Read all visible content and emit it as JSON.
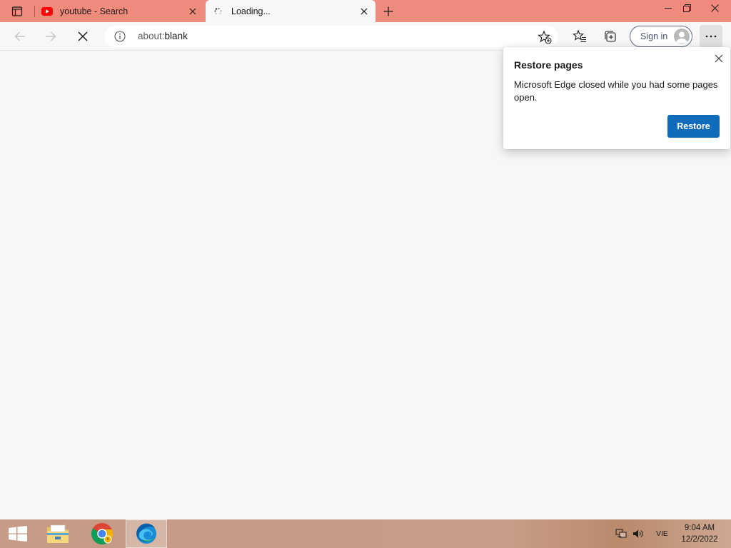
{
  "browser": {
    "tabs": [
      {
        "title": "youtube - Search",
        "state": "inactive",
        "icon": "youtube-icon"
      },
      {
        "title": "Loading...",
        "state": "active",
        "icon": "loading-spinner-icon"
      }
    ],
    "address_bar": {
      "url_prefix": "about:",
      "url_suffix": "blank"
    },
    "sign_in_label": "Sign in"
  },
  "popup": {
    "title": "Restore pages",
    "message": "Microsoft Edge closed while you had some pages open.",
    "restore_label": "Restore"
  },
  "taskbar": {
    "apps": [
      "file-explorer-icon",
      "chrome-icon",
      "edge-icon"
    ],
    "language": "VIE",
    "time": "9:04 AM",
    "date": "12/2/2022"
  },
  "colors": {
    "tab_strip": "#f08a7c",
    "page_background": "#f7f7f7",
    "accent_button": "#0f6cbd",
    "youtube_red": "#ff0000"
  }
}
